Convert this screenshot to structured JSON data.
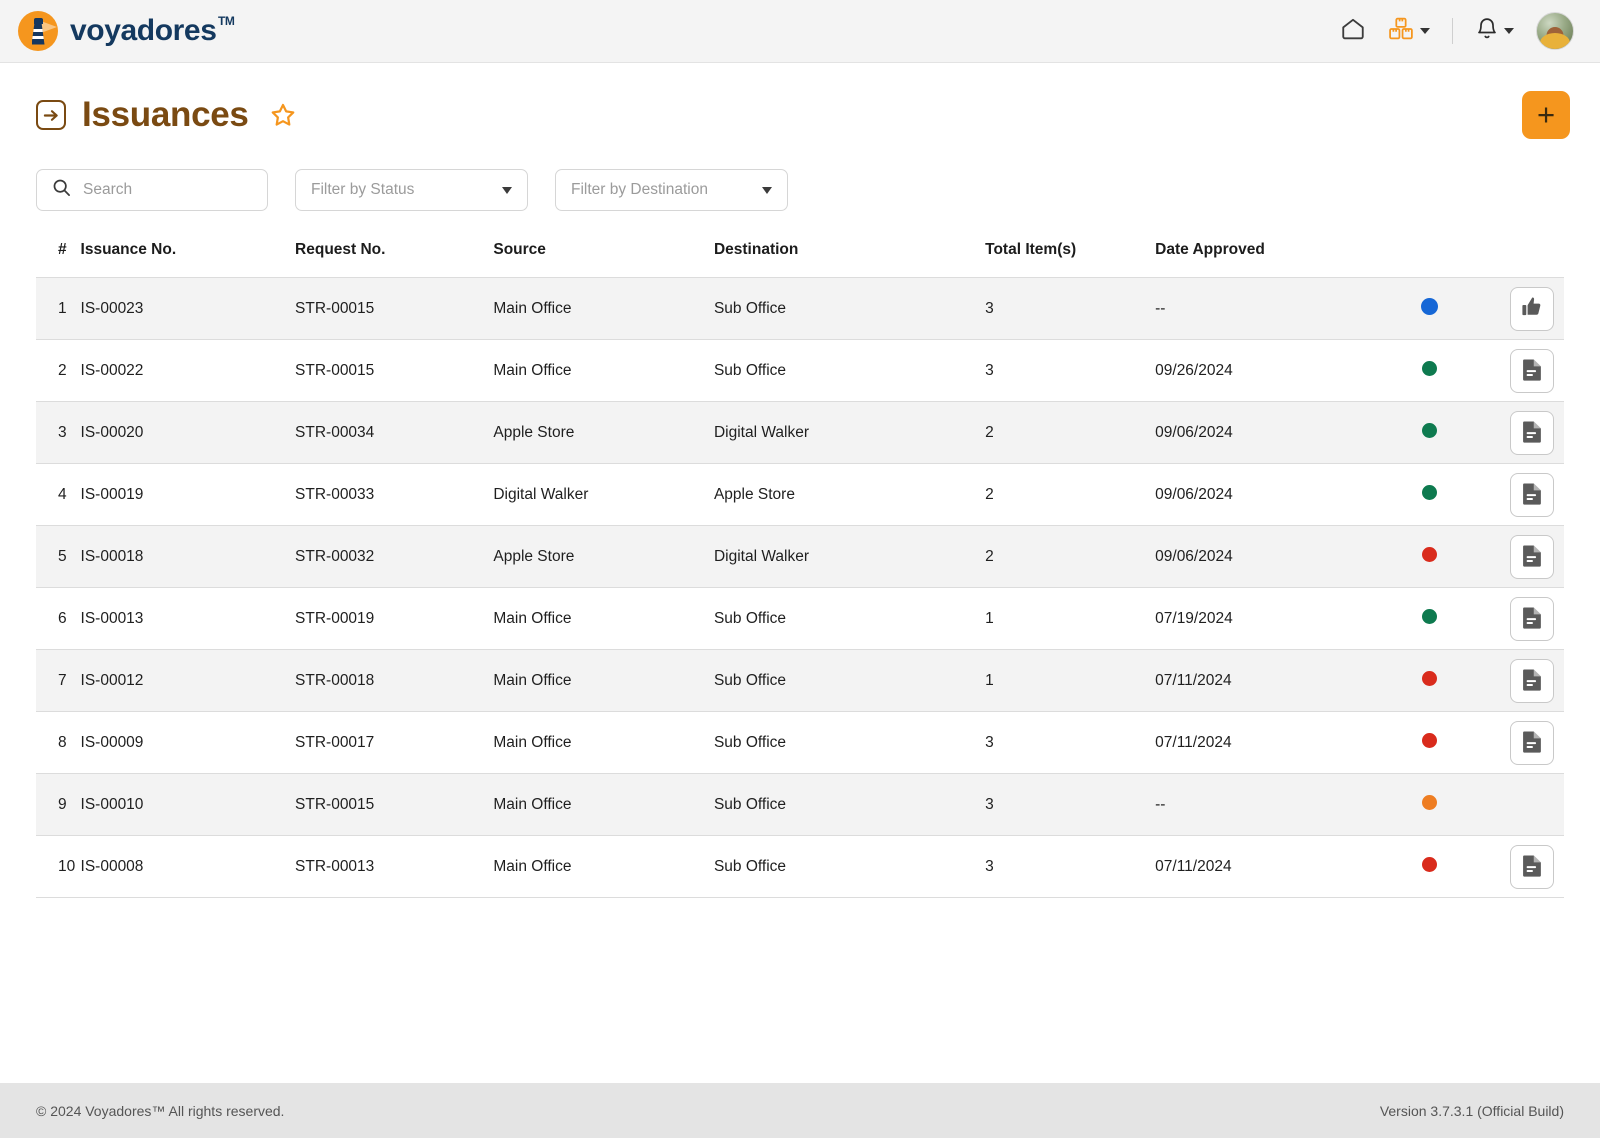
{
  "header": {
    "brand_name": "voyadores",
    "brand_tm": "TM",
    "icons": {
      "home": "home-icon",
      "inventory": "boxes-icon",
      "bell": "bell-icon",
      "avatar": "user-avatar"
    }
  },
  "page": {
    "title": "Issuances",
    "title_icon": "arrow-right-in-box-icon",
    "favorite_icon": "star-outline-icon",
    "add_button_label": "+"
  },
  "filters": {
    "search_placeholder": "Search",
    "search_value": "",
    "status_label": "Filter by Status",
    "destination_label": "Filter by Destination"
  },
  "table": {
    "columns": [
      "#",
      "Issuance No.",
      "Request No.",
      "Source",
      "Destination",
      "Total Item(s)",
      "Date Approved"
    ],
    "rows": [
      {
        "idx": "1",
        "issuance": "IS-00023",
        "request": "STR-00015",
        "source": "Main Office",
        "destination": "Sub Office",
        "total": "3",
        "date": "--",
        "status_color": "#1667D6",
        "status_name": "status-blue",
        "action": "thumbs-up-icon"
      },
      {
        "idx": "2",
        "issuance": "IS-00022",
        "request": "STR-00015",
        "source": "Main Office",
        "destination": "Sub Office",
        "total": "3",
        "date": "09/26/2024",
        "status_color": "#0E7A4F",
        "status_name": "status-green",
        "action": "document-icon"
      },
      {
        "idx": "3",
        "issuance": "IS-00020",
        "request": "STR-00034",
        "source": "Apple Store",
        "destination": "Digital Walker",
        "total": "2",
        "date": "09/06/2024",
        "status_color": "#0E7A4F",
        "status_name": "status-green",
        "action": "document-icon"
      },
      {
        "idx": "4",
        "issuance": "IS-00019",
        "request": "STR-00033",
        "source": "Digital Walker",
        "destination": "Apple Store",
        "total": "2",
        "date": "09/06/2024",
        "status_color": "#0E7A4F",
        "status_name": "status-green",
        "action": "document-icon"
      },
      {
        "idx": "5",
        "issuance": "IS-00018",
        "request": "STR-00032",
        "source": "Apple Store",
        "destination": "Digital Walker",
        "total": "2",
        "date": "09/06/2024",
        "status_color": "#D92B1C",
        "status_name": "status-red",
        "action": "document-icon"
      },
      {
        "idx": "6",
        "issuance": "IS-00013",
        "request": "STR-00019",
        "source": "Main Office",
        "destination": "Sub Office",
        "total": "1",
        "date": "07/19/2024",
        "status_color": "#0E7A4F",
        "status_name": "status-green",
        "action": "document-icon"
      },
      {
        "idx": "7",
        "issuance": "IS-00012",
        "request": "STR-00018",
        "source": "Main Office",
        "destination": "Sub Office",
        "total": "1",
        "date": "07/11/2024",
        "status_color": "#D92B1C",
        "status_name": "status-red",
        "action": "document-icon"
      },
      {
        "idx": "8",
        "issuance": "IS-00009",
        "request": "STR-00017",
        "source": "Main Office",
        "destination": "Sub Office",
        "total": "3",
        "date": "07/11/2024",
        "status_color": "#D92B1C",
        "status_name": "status-red",
        "action": "document-icon"
      },
      {
        "idx": "9",
        "issuance": "IS-00010",
        "request": "STR-00015",
        "source": "Main Office",
        "destination": "Sub Office",
        "total": "3",
        "date": "--",
        "status_color": "#EE7D22",
        "status_name": "status-orange",
        "action": "none"
      },
      {
        "idx": "10",
        "issuance": "IS-00008",
        "request": "STR-00013",
        "source": "Main Office",
        "destination": "Sub Office",
        "total": "3",
        "date": "07/11/2024",
        "status_color": "#D92B1C",
        "status_name": "status-red",
        "action": "document-icon"
      }
    ]
  },
  "footer": {
    "copyright": "© 2024 Voyadores™ All rights reserved.",
    "version": "Version 3.7.3.1 (Official Build)"
  },
  "colors": {
    "brand_orange": "#F5961E",
    "brand_navy": "#14395F",
    "title_brown": "#7A4A12"
  }
}
